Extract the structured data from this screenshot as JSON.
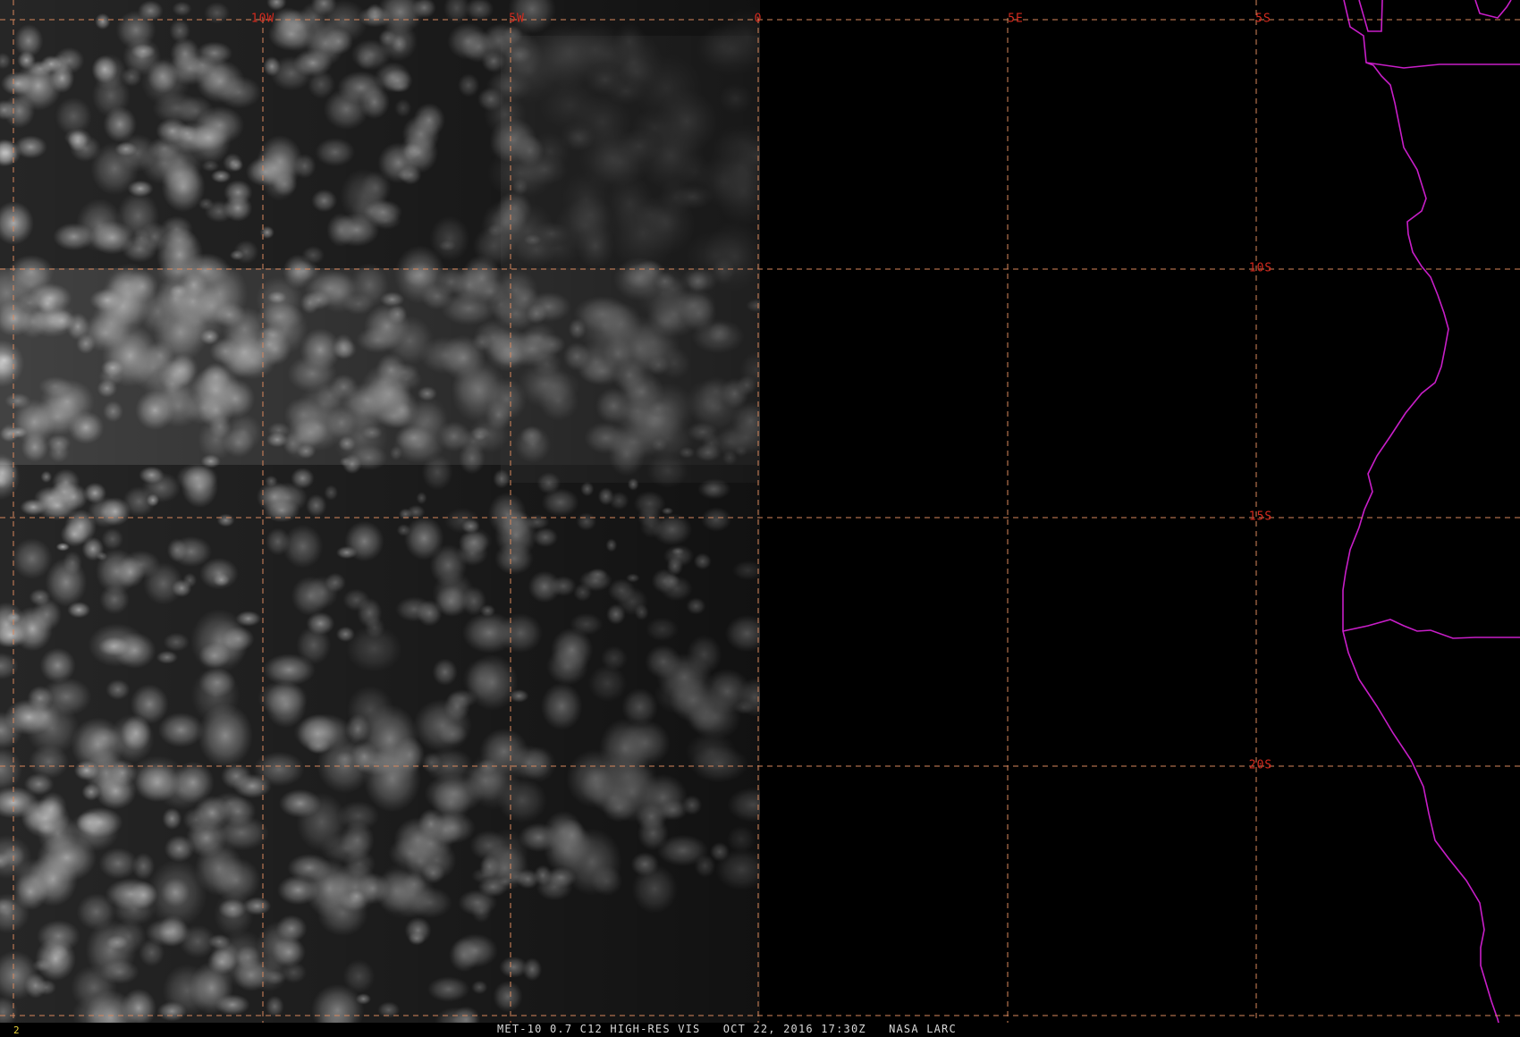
{
  "image": {
    "caption": "MET-10 0.7 C12 HIGH-RES VIS   OCT 22, 2016 17:30Z   NASA LARC",
    "frame_number": "2"
  },
  "grid": {
    "longitude_labels": [
      "10W",
      "5W",
      "0",
      "5E"
    ],
    "latitude_labels": [
      "5S",
      "10S",
      "15S",
      "20S"
    ]
  },
  "colors": {
    "background": "#000000",
    "gridline": "#d7875c",
    "grid_label": "#d42a1e",
    "coastline": "#c81ec8",
    "caption_text": "#d8d8d8",
    "frame_number": "#e8d23a"
  }
}
